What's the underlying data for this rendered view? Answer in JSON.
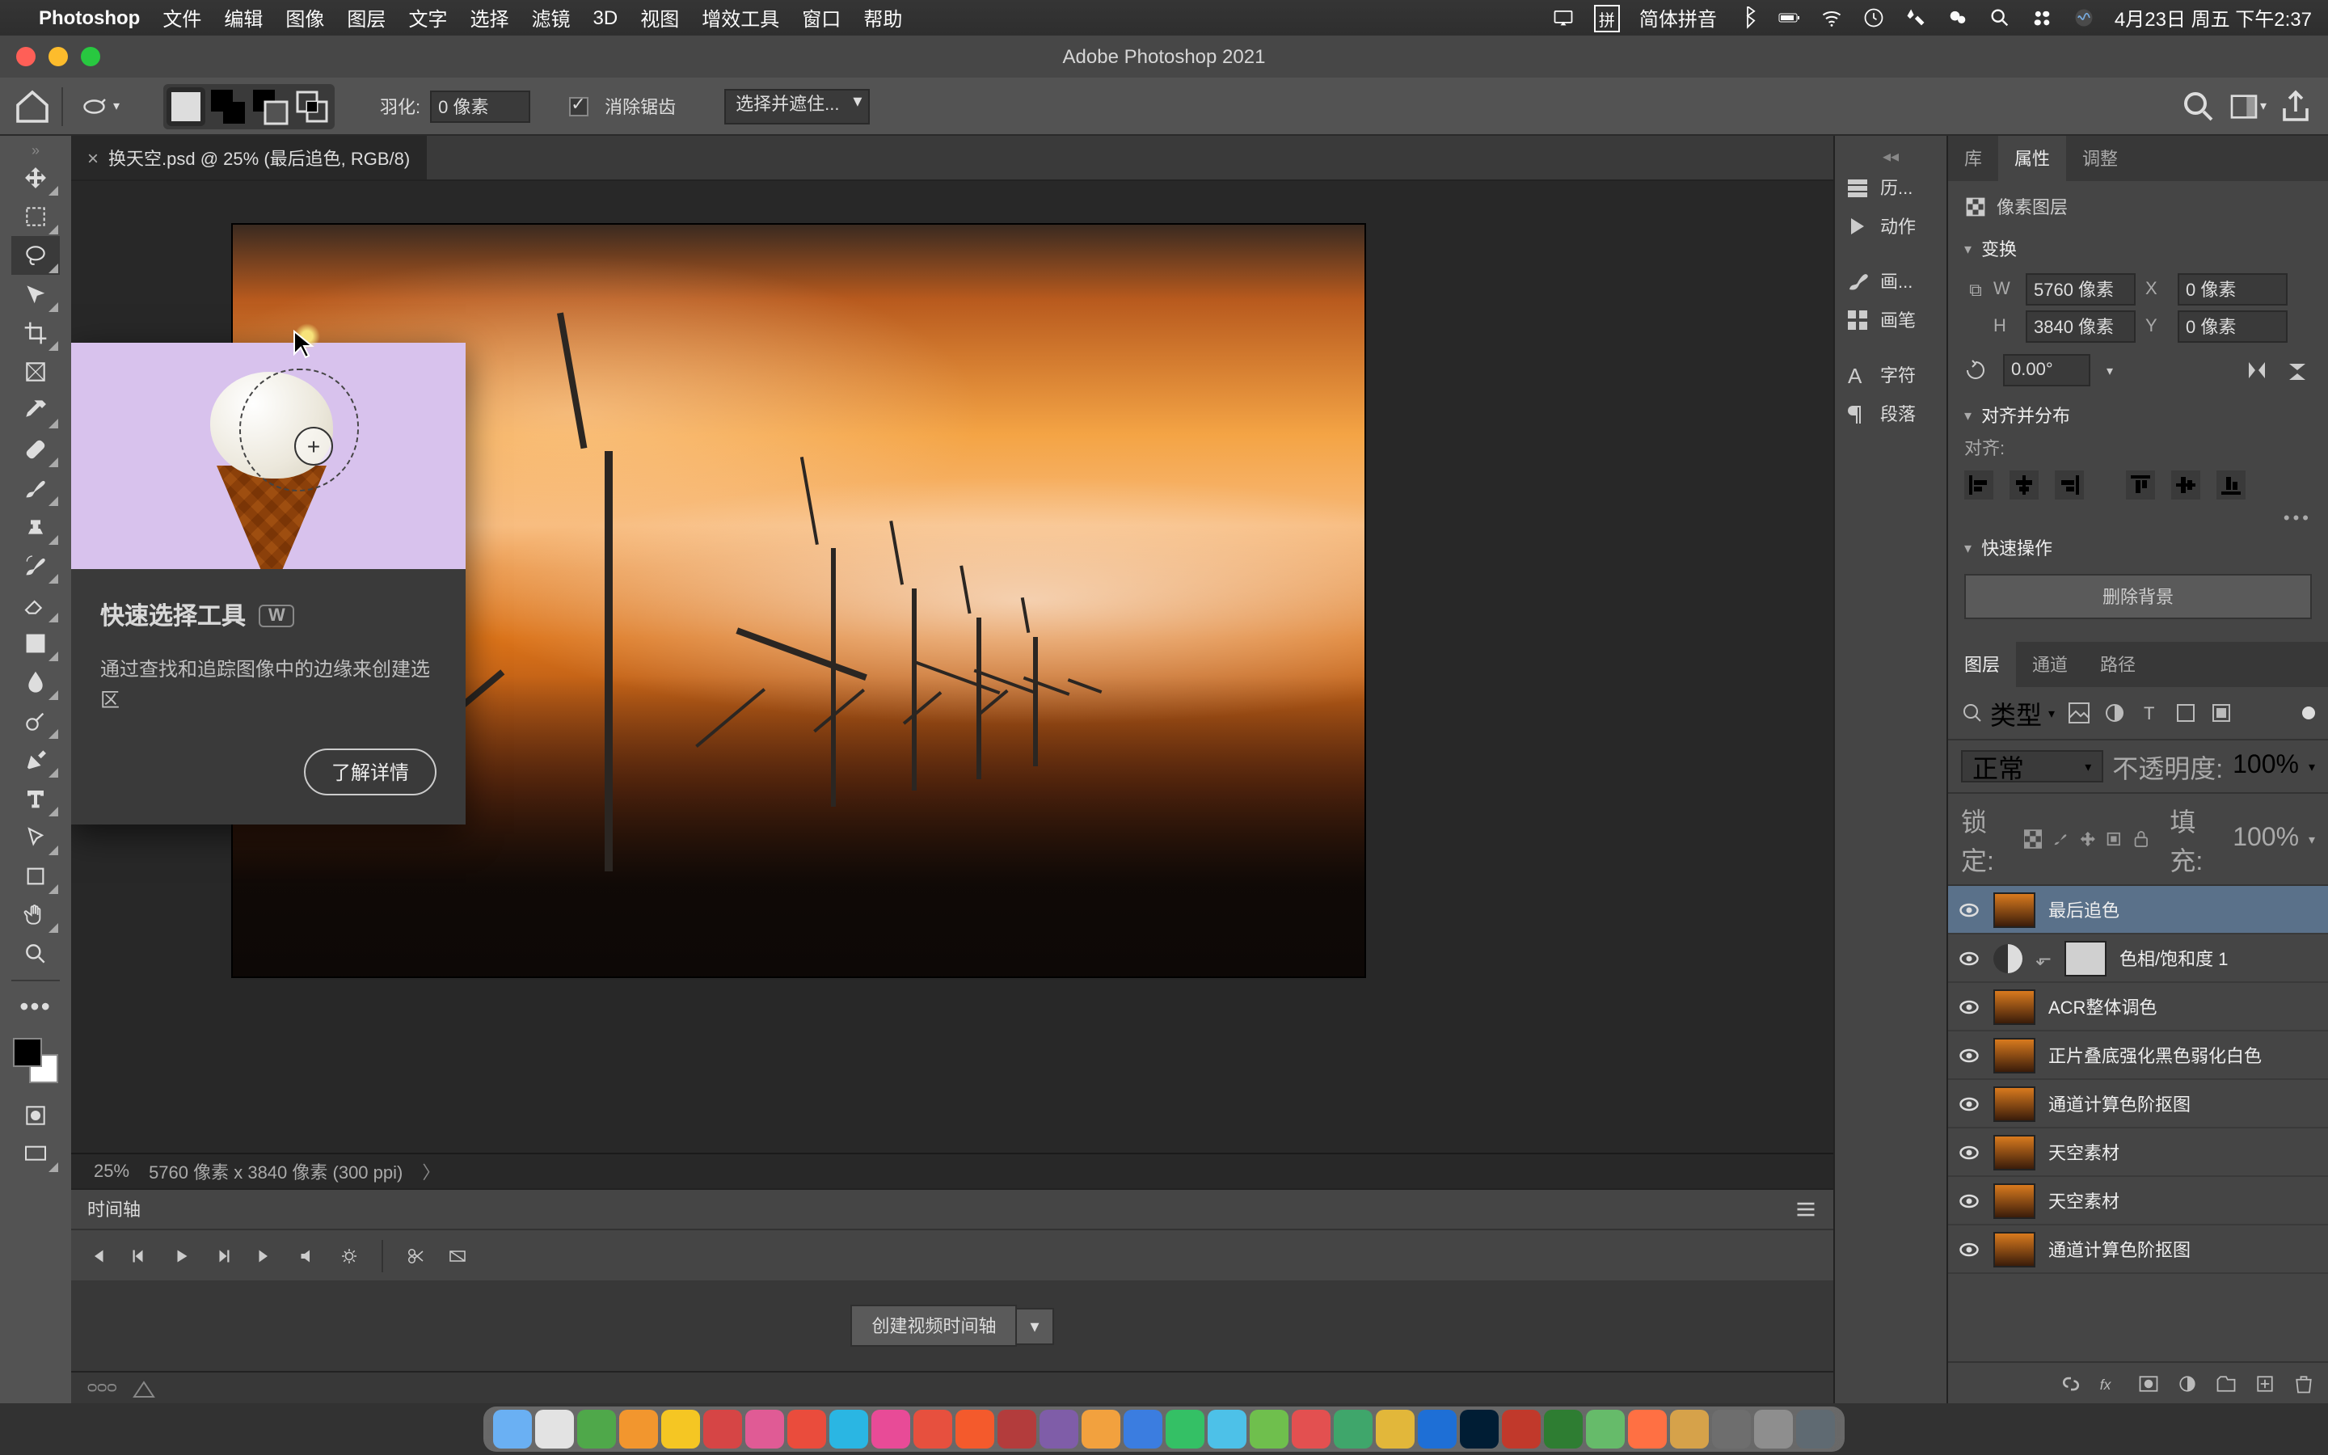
{
  "menubar": {
    "app": "Photoshop",
    "items": [
      "文件",
      "编辑",
      "图像",
      "图层",
      "文字",
      "选择",
      "滤镜",
      "3D",
      "视图",
      "增效工具",
      "窗口",
      "帮助"
    ],
    "ime": "简体拼音",
    "clock": "4月23日 周五 下午2:37"
  },
  "window": {
    "title": "Adobe Photoshop 2021"
  },
  "options": {
    "feather_label": "羽化:",
    "feather_value": "0 像素",
    "antialias": "消除锯齿",
    "select_mask": "选择并遮住..."
  },
  "document": {
    "tab": "换天空.psd @ 25% (最后追色, RGB/8)",
    "zoom": "25%",
    "dims": "5760 像素 x 3840 像素 (300 ppi)"
  },
  "tooltip": {
    "title": "快速选择工具",
    "key": "W",
    "desc": "通过查找和追踪图像中的边缘来创建选区",
    "learn": "了解详情"
  },
  "timeline": {
    "label": "时间轴",
    "create": "创建视频时间轴"
  },
  "mini_dock": [
    "历...",
    "动作",
    "画...",
    "画笔",
    "字符",
    "段落"
  ],
  "properties": {
    "tabs": [
      "库",
      "属性",
      "调整"
    ],
    "kind": "像素图层",
    "sections": {
      "transform": "变换",
      "align": "对齐并分布",
      "align_lbl": "对齐:",
      "quick": "快速操作"
    },
    "w_lbl": "W",
    "h_lbl": "H",
    "x_lbl": "X",
    "y_lbl": "Y",
    "w": "5760 像素",
    "h": "3840 像素",
    "x": "0 像素",
    "y": "0 像素",
    "rot": "0.00°",
    "delete_bg": "删除背景"
  },
  "layers": {
    "tabs": [
      "图层",
      "通道",
      "路径"
    ],
    "filter": "类型",
    "blend": "正常",
    "opacity_lbl": "不透明度:",
    "opacity": "100%",
    "lock_lbl": "锁定:",
    "fill_lbl": "填充:",
    "fill": "100%",
    "items": [
      {
        "name": "最后追色",
        "sel": true,
        "kind": "img"
      },
      {
        "name": "色相/饱和度 1",
        "kind": "adj"
      },
      {
        "name": "ACR整体调色",
        "kind": "img"
      },
      {
        "name": "正片叠底强化黑色弱化白色",
        "kind": "img"
      },
      {
        "name": "通道计算色阶抠图",
        "kind": "img"
      },
      {
        "name": "天空素材",
        "kind": "img"
      },
      {
        "name": "天空素材",
        "kind": "img"
      },
      {
        "name": "通道计算色阶抠图",
        "kind": "img"
      }
    ]
  },
  "dock_colors": [
    "#6ab0f3",
    "#e3e3e3",
    "#4fa84a",
    "#f2962e",
    "#f5c623",
    "#d64545",
    "#e05b95",
    "#ea4c3c",
    "#2ab6e3",
    "#e84b97",
    "#e7503e",
    "#f45a2c",
    "#b33c3c",
    "#7f5da8",
    "#f2a13e",
    "#3b7de0",
    "#34c065",
    "#4dc1e8",
    "#6fbf4d",
    "#e35050",
    "#3fa66b",
    "#e2b73a",
    "#1e6fd6",
    "#001d34",
    "#c1392b",
    "#2e7d32",
    "#66bb6a",
    "#ff7043",
    "#d6a24a",
    "#6e6e6e",
    "#8e8e8e",
    "#5f6a72"
  ]
}
